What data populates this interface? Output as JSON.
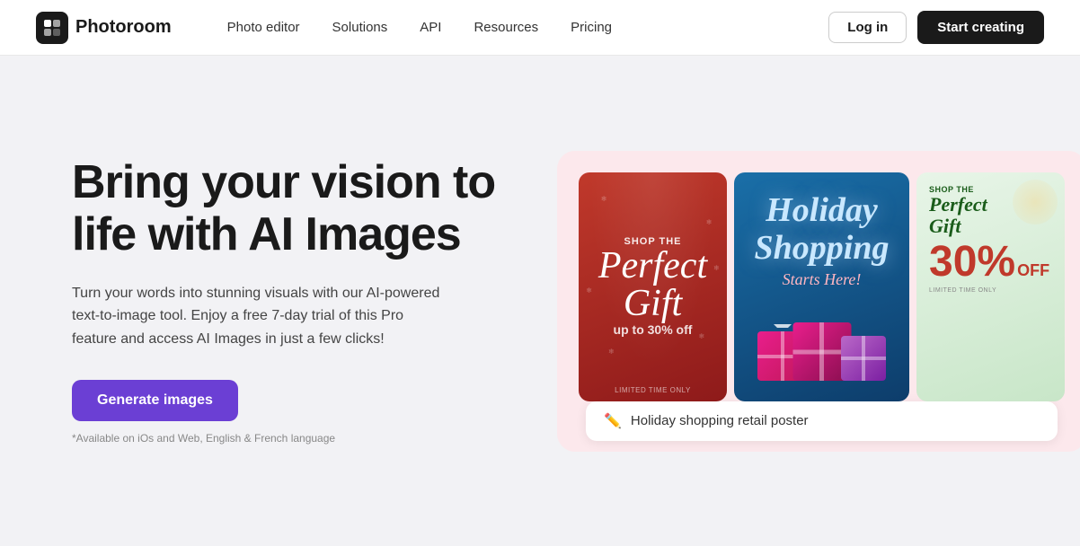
{
  "navbar": {
    "logo_text": "Photoroom",
    "links": [
      {
        "label": "Photo editor",
        "id": "photo-editor"
      },
      {
        "label": "Solutions",
        "id": "solutions"
      },
      {
        "label": "API",
        "id": "api"
      },
      {
        "label": "Resources",
        "id": "resources"
      },
      {
        "label": "Pricing",
        "id": "pricing"
      }
    ],
    "login_label": "Log in",
    "start_label": "Start creating"
  },
  "hero": {
    "heading": "Bring your vision to life with AI Images",
    "subtext": "Turn your words into stunning visuals with our AI-powered text-to-image tool. Enjoy a free 7-day trial of this Pro feature and access AI Images in just a few clicks!",
    "cta_label": "Generate images",
    "footnote": "*Available on iOs and Web, English & French language"
  },
  "showcase": {
    "cards": [
      {
        "id": "card-1",
        "type": "red",
        "line1": "Shop the",
        "line2": "Perfect Gift",
        "line3": "up to 30% off",
        "bottom": "LIMITED TIME ONLY"
      },
      {
        "id": "card-2",
        "type": "blue",
        "line1": "Holiday Shopping",
        "line2": "Starts Here!"
      },
      {
        "id": "card-3",
        "type": "green",
        "line1": "Shop the",
        "line2": "Perfect Gift",
        "line3": "30%",
        "line4": "OFF",
        "bottom": "LIMITED TIME ONLY"
      }
    ],
    "caption": {
      "icon": "✏️",
      "text": "Holiday shopping retail poster"
    }
  }
}
